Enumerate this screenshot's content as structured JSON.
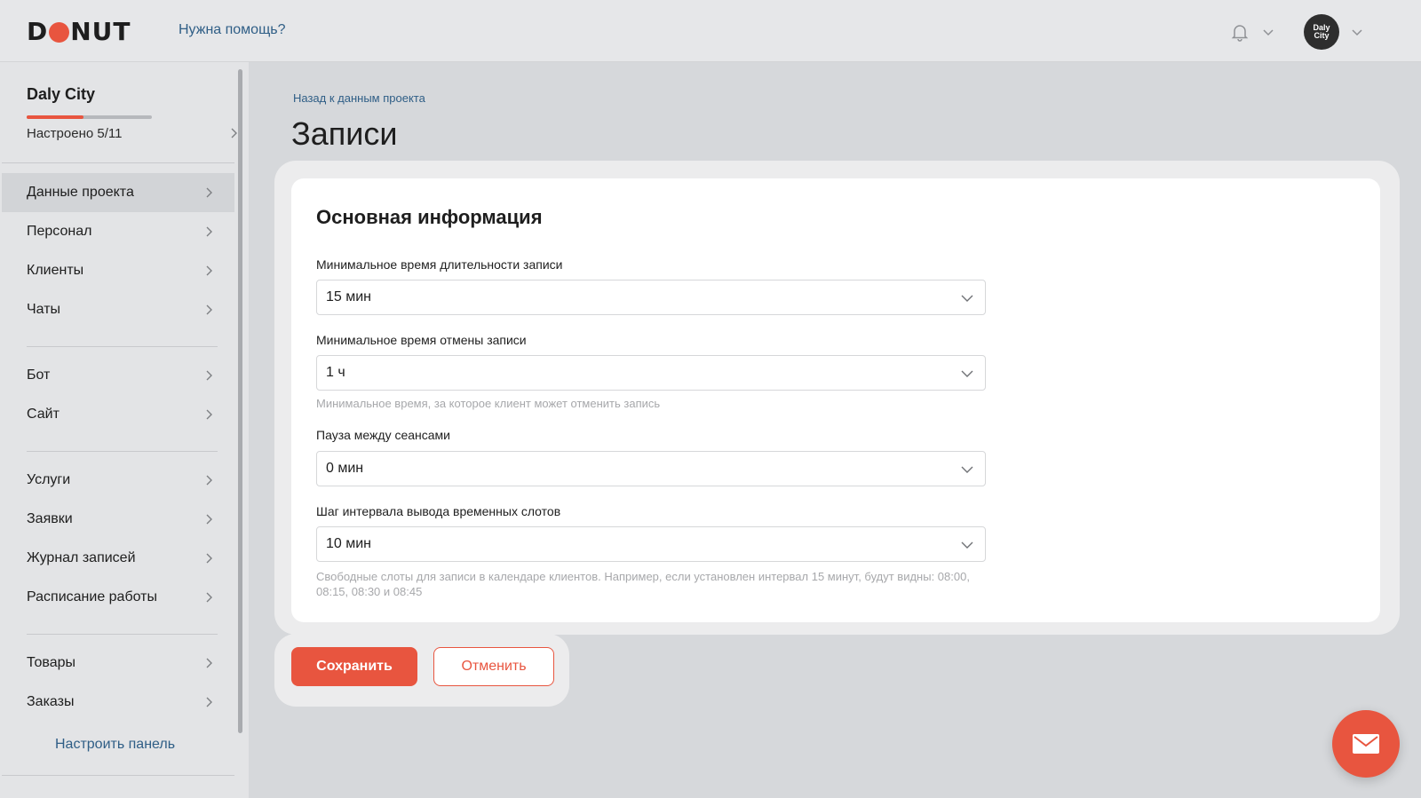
{
  "topbar": {
    "logo": "DONUT",
    "help_link": "Нужна помощь?",
    "avatar_text": "Daly City",
    "icons": [
      "bell-icon",
      "chevron-down-icon",
      "avatar",
      "chevron-down-icon"
    ]
  },
  "sidebar": {
    "project_name": "Daly City",
    "project_status": "Настроено 5/11",
    "progress": {
      "done": 5,
      "total": 11
    },
    "groups": [
      [
        "Данные проекта",
        "Персонал",
        "Клиенты",
        "Чаты"
      ],
      [
        "Бот",
        "Сайт"
      ],
      [
        "Услуги",
        "Заявки",
        "Журнал записей",
        "Расписание работы"
      ],
      [
        "Товары",
        "Заказы"
      ]
    ],
    "active_item": "Данные проекта",
    "configure_link": "Настроить панель"
  },
  "main": {
    "back_link": "Назад к данным проекта",
    "title": "Записи",
    "section_title": "Основная информация",
    "fields": [
      {
        "label": "Минимальное время длительности записи",
        "value": "15 мин",
        "hint": ""
      },
      {
        "label": "Минимальное время отмены записи",
        "value": "1 ч",
        "hint": "Минимальное время, за которое клиент может отменить запись"
      },
      {
        "label": "Пауза между сеансами",
        "value": "0 мин",
        "hint": ""
      },
      {
        "label": "Шаг интервала вывода временных слотов",
        "value": "10 мин",
        "hint": "Свободные слоты для записи в календаре клиентов. Например, если установлен интервал 15 минут, будут видны: 08:00, 08:15, 08:30 и 08:45"
      }
    ],
    "save_label": "Сохранить",
    "cancel_label": "Отменить"
  },
  "colors": {
    "accent": "#e8553f",
    "link": "#2f5e86",
    "background": "#d6d8db",
    "card": "#ffffff"
  }
}
